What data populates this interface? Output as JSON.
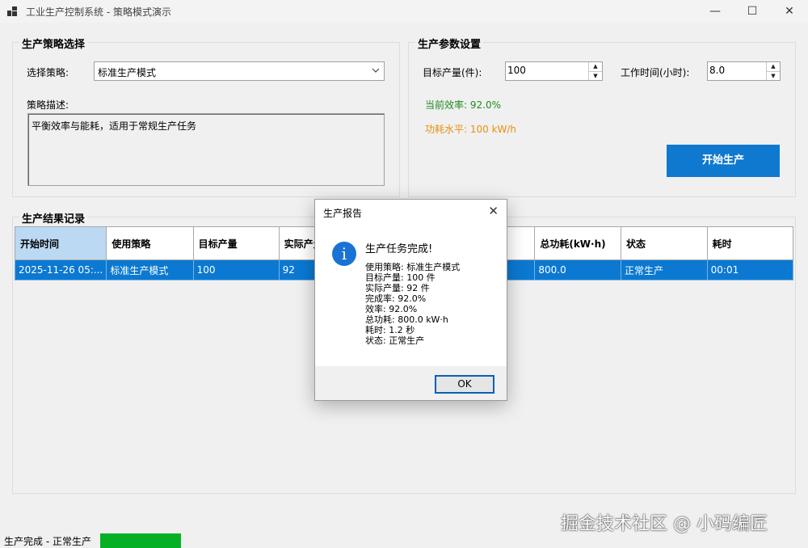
{
  "window": {
    "title": "工业生产控制系统 - 策略模式演示",
    "minimize": "—",
    "maximize": "☐",
    "close": "✕"
  },
  "strategy_group": {
    "title": "生产策略选择",
    "select_label": "选择策略:",
    "selected": "标准生产模式",
    "desc_label": "策略描述:",
    "description": "平衡效率与能耗，适用于常规生产任务"
  },
  "params_group": {
    "title": "生产参数设置",
    "target_label": "目标产量(件):",
    "target_value": "100",
    "hours_label": "工作时间(小时):",
    "hours_value": "8.0",
    "efficiency_text": "当前效率: 92.0%",
    "power_text": "功耗水平: 100 kW/h",
    "start_button": "开始生产",
    "efficiency_color": "#1e8a1e",
    "power_color": "#e8900c",
    "button_color": "#0f79cf"
  },
  "results_group": {
    "title": "生产结果记录",
    "columns": [
      "开始时间",
      "使用策略",
      "目标产量",
      "实际产量",
      "",
      "",
      "总功耗(kW·h)",
      "状态",
      "耗时"
    ],
    "rows": [
      [
        "2025-11-26 05:...",
        "标准生产模式",
        "100",
        "92",
        "",
        "",
        "800.0",
        "正常生产",
        "00:01"
      ]
    ]
  },
  "status_bar": {
    "text": "生产完成 - 正常生产",
    "progress": 1.0
  },
  "watermark": "掘金技术社区 @ 小码编匠",
  "dialog": {
    "title": "生产报告",
    "close": "✕",
    "icon": "info-icon",
    "heading": "生产任务完成!",
    "lines": [
      "使用策略: 标准生产模式",
      "目标产量: 100 件",
      "实际产量: 92 件",
      "完成率: 92.0%",
      "效率: 92.0%",
      "总功耗: 800.0 kW·h",
      "耗时: 1.2 秒",
      "状态: 正常生产"
    ],
    "ok": "OK"
  }
}
